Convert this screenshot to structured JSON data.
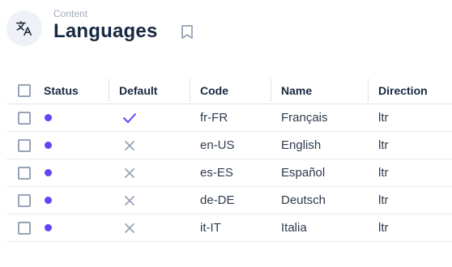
{
  "header": {
    "breadcrumb": "Content",
    "title": "Languages",
    "module_icon": "translate-icon",
    "bookmark_icon": "bookmark-icon"
  },
  "table": {
    "columns": [
      "Status",
      "Default",
      "Code",
      "Name",
      "Direction"
    ],
    "rows": [
      {
        "status": "active",
        "default": true,
        "code": "fr-FR",
        "name": "Français",
        "direction": "ltr"
      },
      {
        "status": "active",
        "default": false,
        "code": "en-US",
        "name": "English",
        "direction": "ltr"
      },
      {
        "status": "active",
        "default": false,
        "code": "es-ES",
        "name": "Español",
        "direction": "ltr"
      },
      {
        "status": "active",
        "default": false,
        "code": "de-DE",
        "name": "Deutsch",
        "direction": "ltr"
      },
      {
        "status": "active",
        "default": false,
        "code": "it-IT",
        "name": "Italia",
        "direction": "ltr"
      }
    ]
  },
  "colors": {
    "accent": "#6644f5",
    "title": "#172940",
    "muted": "#a2abbd",
    "false_icon": "#97a3b6"
  }
}
